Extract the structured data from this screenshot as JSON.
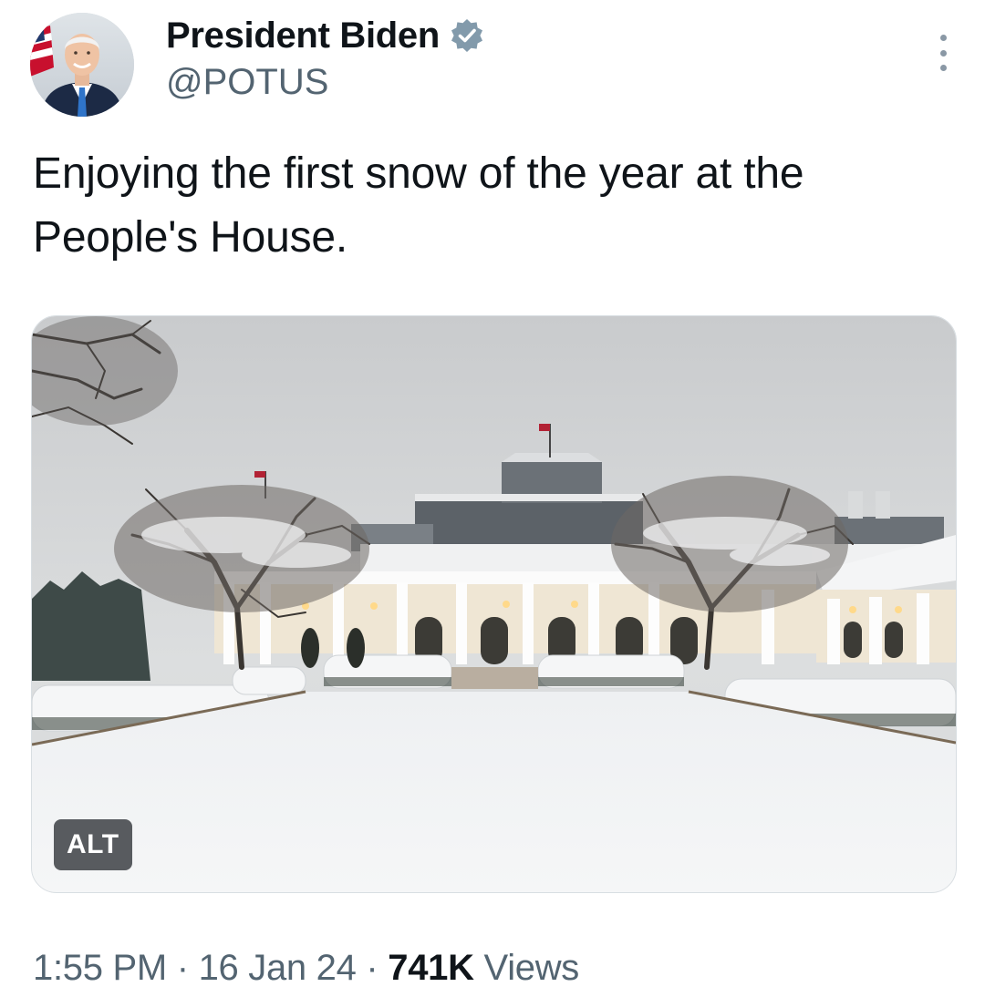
{
  "author": {
    "display_name": "President Biden",
    "handle": "@POTUS",
    "verified": true,
    "badge_color": "#829aab"
  },
  "tweet": {
    "text": "Enjoying the first snow of the year at the People's House."
  },
  "media": {
    "alt_label": "ALT"
  },
  "meta": {
    "time": "1:55 PM",
    "separator": "·",
    "date": "16 Jan 24",
    "views_count": "741K",
    "views_label": "Views"
  },
  "colors": {
    "text_primary": "#0f1419",
    "text_secondary": "#536471"
  }
}
